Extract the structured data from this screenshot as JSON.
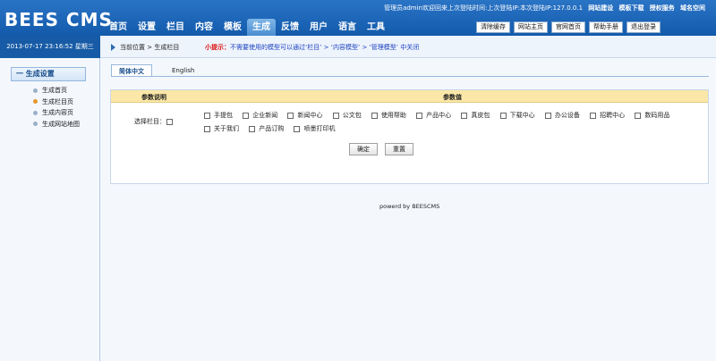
{
  "header": {
    "logo": "BEES CMS",
    "welcome": "管理员admin欢迎回来上次登陆时间:上次登陆IP:本次登陆IP:127.0.0.1",
    "links": [
      "网站建设",
      "模板下载",
      "授权服务",
      "域名空间"
    ],
    "nav": [
      "首页",
      "设置",
      "栏目",
      "内容",
      "模板",
      "生成",
      "反馈",
      "用户",
      "语言",
      "工具"
    ],
    "nav_active": "生成",
    "buttons": [
      "清除缓存",
      "网站主页",
      "官网首页",
      "帮助手册",
      "退出登录"
    ]
  },
  "datebar": {
    "text": "2013-07-17 23:16:52 星期三"
  },
  "sidebar": {
    "section_title": "一 生成设置",
    "items": [
      "生成首页",
      "生成栏目页",
      "生成内容页",
      "生成网站地图"
    ],
    "active_item": "生成栏目页"
  },
  "breadcrumb": {
    "text": "当前位置 > 生成栏目",
    "tip_label": "小提示：",
    "tip_text": "不需要使用的模型可以通过‘栏目’ > ‘内容模型’ > ‘管理模型’ 中关闭"
  },
  "tabs": [
    "简体中文",
    "English"
  ],
  "table": {
    "col1": "参数说明",
    "col2": "参数值",
    "row_label": "选择栏目：",
    "options": [
      "手提包",
      "企业新闻",
      "新闻中心",
      "公文包",
      "使用帮助",
      "产品中心",
      "真皮包",
      "下载中心",
      "办公设备",
      "招聘中心",
      "数码用品",
      "关于我们",
      "产品订购",
      "喷墨打印机"
    ]
  },
  "actions": {
    "confirm": "确定",
    "reset": "重置"
  },
  "footer": {
    "text": "powerd by BEESCMS"
  },
  "colors": {
    "header_blue": "#1d66b9",
    "table_header": "#fbe7a7",
    "accent_orange": "#e8962c"
  }
}
